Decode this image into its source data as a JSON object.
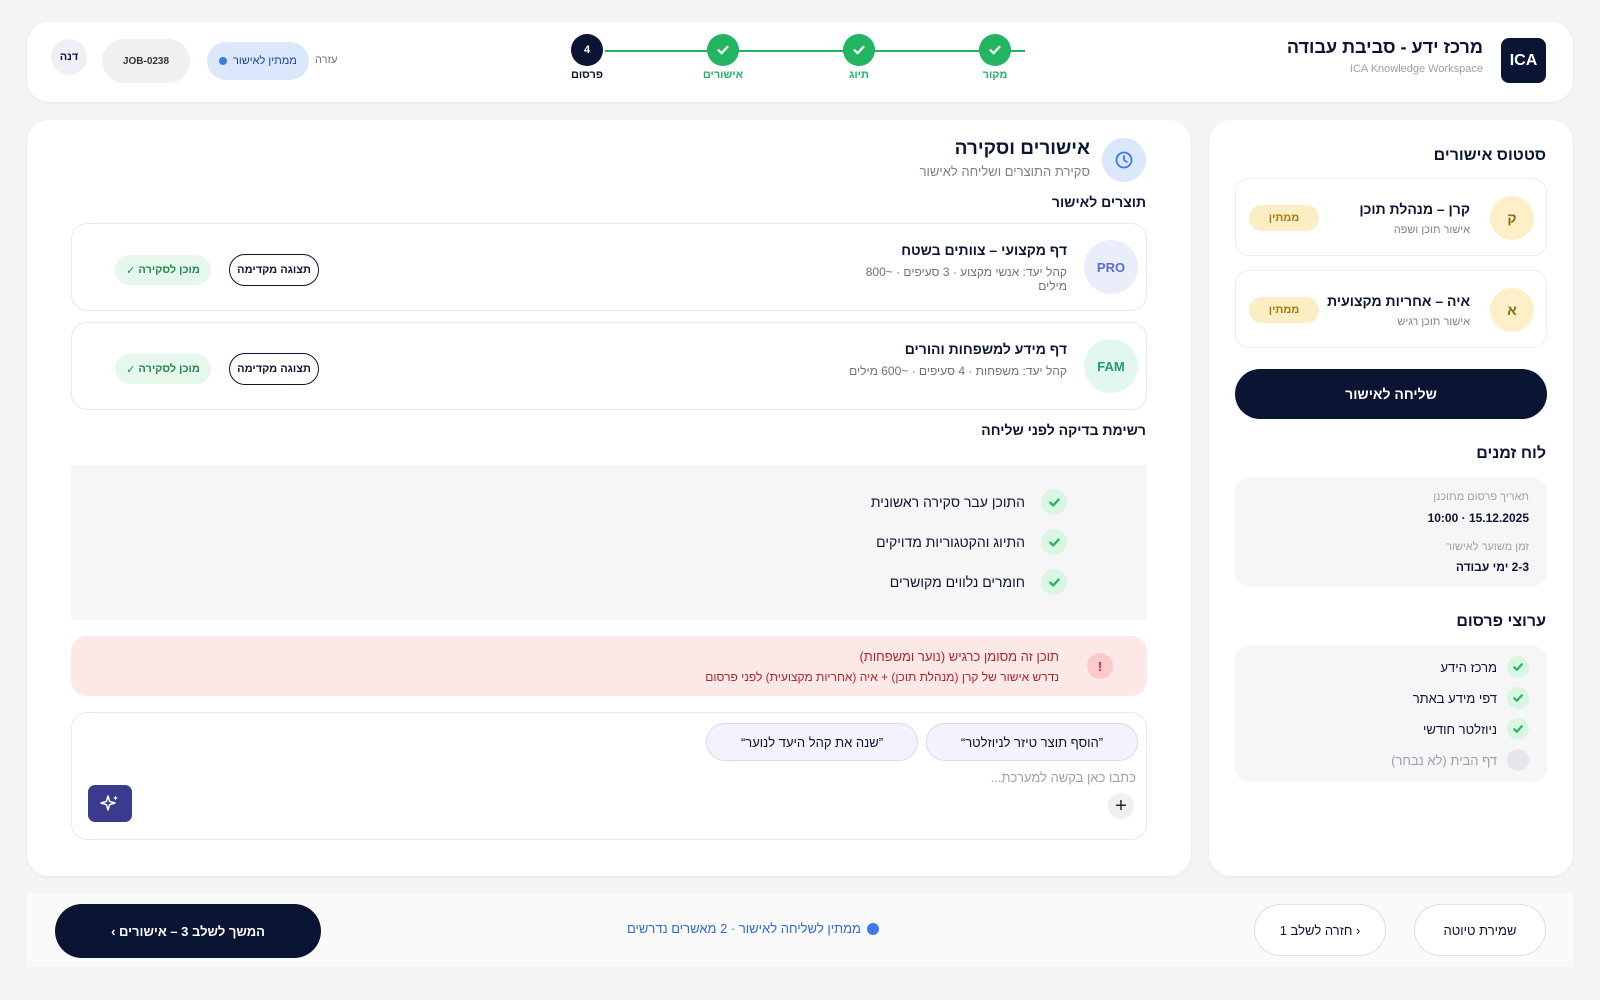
{
  "colors": {
    "brand_navy": "#0a1433",
    "success_green": "#22b561",
    "pending_yellow": "#fbeec5",
    "alert_red": "#b02626",
    "accent_blue": "#3b7ce8",
    "ai_purple": "#3a3a8e"
  },
  "header": {
    "logo": "ICA",
    "title": "מרכז ידע - סביבת עבודה",
    "subtitle": "ICA Knowledge Workspace",
    "steps": [
      {
        "label": "מקור",
        "state": "done",
        "icon": "check-icon"
      },
      {
        "label": "תיוג",
        "state": "done",
        "icon": "check-icon"
      },
      {
        "label": "אישורים",
        "state": "done",
        "icon": "check-icon"
      },
      {
        "label": "פרסום",
        "state": "current",
        "number": "4"
      }
    ],
    "help": "עזרה",
    "status": "ממתין לאישור",
    "job_id": "JOB-0238",
    "user": "דנה"
  },
  "sidebar": {
    "approvals_heading": "סטטוס אישורים",
    "approvers": [
      {
        "initial": "ק",
        "name": "קרן – מנהלת תוכן",
        "role": "אישור תוכן ושפה",
        "status": "ממתין"
      },
      {
        "initial": "א",
        "name": "איה – אחריות מקצועית",
        "role": "אישור תוכן רגיש",
        "status": "ממתין"
      }
    ],
    "send_button": "שליחה לאישור",
    "timeline_heading": "לוח זמנים",
    "timeline": {
      "publish_label": "תאריך פרסום מתוכנן",
      "publish_value": "15.12.2025 · 10:00",
      "est_label": "זמן משוער לאישור",
      "est_value": "2-3 ימי עבודה"
    },
    "channels_heading": "ערוצי פרסום",
    "channels": [
      {
        "label": "מרכז הידע",
        "checked": true
      },
      {
        "label": "דפי מידע באתר",
        "checked": true
      },
      {
        "label": "ניוזלטר חודשי",
        "checked": true
      },
      {
        "label": "דף הבית (לא נבחר)",
        "checked": false
      }
    ]
  },
  "main": {
    "icon": "clock-icon",
    "title": "אישורים וסקירה",
    "subtitle": "סקירת התוצרים ושליחה לאישור",
    "products_heading": "תוצרים לאישור",
    "products": [
      {
        "code": "PRO",
        "title": "דף מקצועי – צוותים בשטח",
        "meta": "קהל יעד: אנשי מקצוע · 3 סעיפים · ~800 מילים",
        "preview": "תצוגה מקדימה",
        "ready": "מוכן לסקירה"
      },
      {
        "code": "FAM",
        "title": "דף מידע למשפחות והורים",
        "meta": "קהל יעד: משפחות · 4 סעיפים · ~600 מילים",
        "preview": "תצוגה מקדימה",
        "ready": "מוכן לסקירה"
      }
    ],
    "checklist_heading": "רשימת בדיקה לפני שליחה",
    "checklist": [
      "התוכן עבר סקירה ראשונית",
      "התיוג והקטגוריות מדויקים",
      "חומרים נלווים מקושרים"
    ],
    "alert": {
      "title": "תוכן זה מסומן כרגיש (נוער ומשפחות)",
      "body": "נדרש אישור של קרן (מנהלת תוכן) + איה (אחריות מקצועית) לפני פרסום"
    },
    "composer": {
      "suggestions": [
        "”הוסף תוצר טיזר לניוזלטר“",
        "”שנה את קהל היעד לנוער“"
      ],
      "placeholder": "כתבו כאן בקשה למערכת..."
    }
  },
  "footer": {
    "save_draft": "שמירת טיוטה",
    "back": "‹ חזרה לשלב 1",
    "status": "ממתין לשליחה לאישור · 2 מאשרים נדרשים",
    "continue": "המשך לשלב 3 – אישורים ›"
  }
}
